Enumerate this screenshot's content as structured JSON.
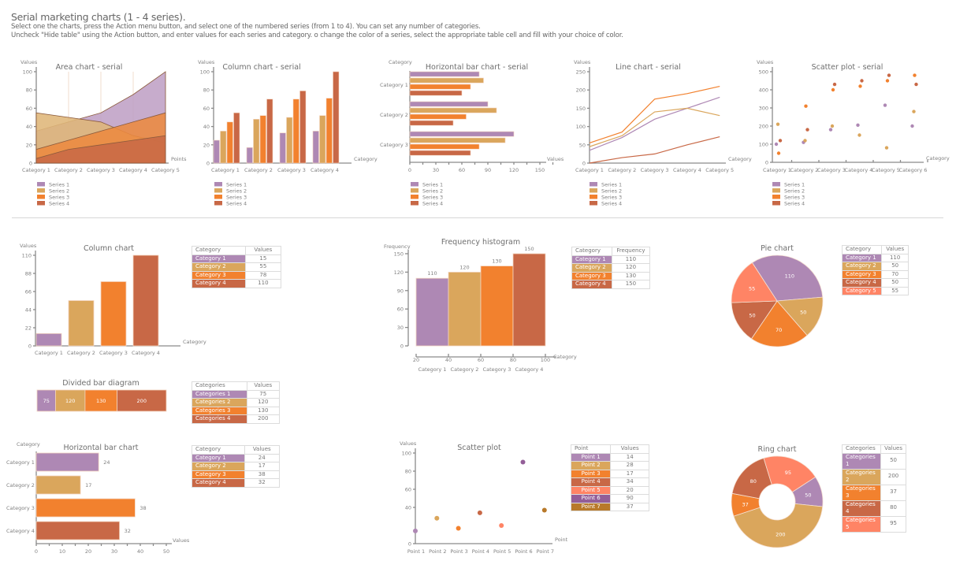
{
  "header": {
    "title": "Serial marketing charts (1 - 4 series).",
    "line1": "Select one the charts, press the Action menu button, and select one of the numbered series (from 1 to 4). You can set any number of categories.",
    "line2": "Uncheck \"Hide table\" using the Action button, and enter values for each series and category. o change the color of a series, select the appropriate table cell and fill with your choice of color."
  },
  "colors": {
    "c1": "#AE88B4",
    "c2": "#DAA65C",
    "c3": "#F2812E",
    "c4": "#C86846",
    "c5": "#FF8465",
    "c6": "#935E98",
    "c7": "#B8792A"
  },
  "chart_data": [
    {
      "id": "area",
      "type": "area",
      "title": "Area chart - serial",
      "ylabel": "Values",
      "xlabel": "Points",
      "ylim": [
        0,
        100
      ],
      "yticks": [
        0,
        20,
        40,
        60,
        80,
        100
      ],
      "categories": [
        "Category 1",
        "Category 2",
        "Category 3",
        "Category 4",
        "Category 5"
      ],
      "series": [
        {
          "name": "Series 1",
          "values": [
            35,
            45,
            55,
            75,
            100
          ]
        },
        {
          "name": "Series 2",
          "values": [
            55,
            50,
            45,
            30,
            22
          ]
        },
        {
          "name": "Series 3",
          "values": [
            15,
            25,
            35,
            45,
            55
          ]
        },
        {
          "name": "Series 4",
          "values": [
            5,
            15,
            20,
            25,
            30
          ]
        }
      ],
      "legend": "bottom-left"
    },
    {
      "id": "colserial",
      "type": "bar",
      "title": "Column chart - serial",
      "ylabel": "Values",
      "xlabel": "Category",
      "ylim": [
        0,
        100
      ],
      "yticks": [
        0,
        20,
        40,
        60,
        80,
        100
      ],
      "categories": [
        "Category 1",
        "Category 2",
        "Category 3",
        "Category 4"
      ],
      "series": [
        {
          "name": "Series 1",
          "values": [
            25,
            17,
            33,
            35
          ]
        },
        {
          "name": "Series 2",
          "values": [
            35,
            48,
            50,
            52
          ]
        },
        {
          "name": "Series 3",
          "values": [
            45,
            52,
            70,
            71
          ]
        },
        {
          "name": "Series 4",
          "values": [
            55,
            70,
            79,
            100
          ]
        }
      ],
      "legend": "bottom-left"
    },
    {
      "id": "hbarserial",
      "type": "bar",
      "orientation": "horizontal",
      "title": "Horizontal bar chart - serial",
      "ylabel": "Category",
      "xlabel": "Values",
      "xlim": [
        0,
        160
      ],
      "xticks": [
        0,
        30,
        60,
        90,
        120,
        150
      ],
      "categories": [
        "Category 1",
        "Category 2",
        "Category 3"
      ],
      "series": [
        {
          "name": "Series 1",
          "values": [
            80,
            90,
            120
          ]
        },
        {
          "name": "Series 2",
          "values": [
            85,
            100,
            110
          ]
        },
        {
          "name": "Series 3",
          "values": [
            70,
            65,
            80
          ]
        },
        {
          "name": "Series 4",
          "values": [
            60,
            50,
            70
          ]
        }
      ],
      "legend": "bottom-left"
    },
    {
      "id": "lineserial",
      "type": "line",
      "title": "Line chart - serial",
      "ylabel": "Values",
      "xlabel": "Category",
      "ylim": [
        0,
        250
      ],
      "yticks": [
        0,
        50,
        100,
        150,
        200,
        250
      ],
      "categories": [
        "Category 1",
        "Category 2",
        "Category 3",
        "Category 4",
        "Category 5"
      ],
      "series": [
        {
          "name": "Series 1",
          "values": [
            35,
            70,
            120,
            150,
            180
          ]
        },
        {
          "name": "Series 2",
          "values": [
            45,
            75,
            140,
            150,
            130
          ]
        },
        {
          "name": "Series 3",
          "values": [
            55,
            85,
            175,
            190,
            210
          ]
        },
        {
          "name": "Series 4",
          "values": [
            0,
            15,
            25,
            50,
            72
          ]
        }
      ],
      "legend": "bottom-left"
    },
    {
      "id": "scatterserial",
      "type": "scatter",
      "title": "Scatter plot - serial",
      "ylabel": "Values",
      "xlabel": "Category",
      "ylim": [
        0,
        500
      ],
      "yticks": [
        0,
        100,
        200,
        300,
        400,
        500
      ],
      "categories": [
        "Category 1",
        "Category 2",
        "Category 3",
        "Category 4",
        "Category 5",
        "Category 6"
      ],
      "series": [
        {
          "name": "Series 1",
          "values": [
            100,
            110,
            180,
            205,
            315,
            200
          ]
        },
        {
          "name": "Series 2",
          "values": [
            210,
            120,
            200,
            150,
            80,
            280
          ]
        },
        {
          "name": "Series 3",
          "values": [
            50,
            310,
            400,
            420,
            450,
            480
          ]
        },
        {
          "name": "Series 4",
          "values": [
            120,
            180,
            430,
            450,
            480,
            430
          ]
        }
      ],
      "legend": "bottom-left"
    },
    {
      "id": "column",
      "type": "bar",
      "title": "Column chart",
      "ylabel": "Values",
      "xlabel": "Category",
      "ylim": [
        0,
        110
      ],
      "yticks": [
        0,
        22,
        44,
        66,
        88,
        110
      ],
      "categories": [
        "Category 1",
        "Category 2",
        "Category 3",
        "Category 4"
      ],
      "values": [
        15,
        55,
        78,
        110
      ],
      "table": {
        "headers": [
          "Category",
          "Values"
        ]
      }
    },
    {
      "id": "histogram",
      "type": "bar",
      "title": "Frequency histogram",
      "ylabel": "Frequency",
      "xlabel": "Category",
      "ylim": [
        0,
        150
      ],
      "yticks": [
        0,
        30,
        60,
        90,
        120,
        150
      ],
      "xticks": [
        20,
        40,
        60,
        80,
        100
      ],
      "categories": [
        "Category 1",
        "Category 2",
        "Category 3",
        "Category 4"
      ],
      "values": [
        110,
        120,
        130,
        150
      ],
      "table": {
        "headers": [
          "Category",
          "Frequency"
        ]
      }
    },
    {
      "id": "pie",
      "type": "pie",
      "title": "Pie chart",
      "categories": [
        "Category 1",
        "Category 2",
        "Category 3",
        "Category 4",
        "Category 5"
      ],
      "values": [
        110,
        50,
        70,
        50,
        55
      ],
      "table": {
        "headers": [
          "Category",
          "Values"
        ]
      }
    },
    {
      "id": "divided",
      "type": "bar",
      "orientation": "stacked-horizontal",
      "title": "Divided bar diagram",
      "categories": [
        "Categories 1",
        "Categories 2",
        "Categories 3",
        "Categories 4"
      ],
      "values": [
        75,
        120,
        130,
        200
      ],
      "table": {
        "headers": [
          "Categories",
          "Values"
        ]
      }
    },
    {
      "id": "hbar",
      "type": "bar",
      "orientation": "horizontal",
      "title": "Horizontal bar chart",
      "ylabel": "Category",
      "xlabel": "Values",
      "xlim": [
        0,
        50
      ],
      "xticks": [
        0,
        10,
        20,
        30,
        40,
        50
      ],
      "categories": [
        "Category 1",
        "Category 2",
        "Category 3",
        "Category 4"
      ],
      "values": [
        24,
        17,
        38,
        32
      ],
      "table": {
        "headers": [
          "Category",
          "Values"
        ]
      }
    },
    {
      "id": "scatter",
      "type": "scatter",
      "title": "Scatter plot",
      "ylabel": "Values",
      "xlabel": "Point",
      "ylim": [
        0,
        100
      ],
      "yticks": [
        0,
        40,
        60,
        80,
        100
      ],
      "categories": [
        "Point 1",
        "Point 2",
        "Point 3",
        "Point 4",
        "Point 5",
        "Point 6",
        "Point 7"
      ],
      "values": [
        14,
        28,
        17,
        34,
        20,
        90,
        37
      ],
      "table": {
        "headers": [
          "Point",
          "Values"
        ]
      }
    },
    {
      "id": "ring",
      "type": "pie",
      "variant": "ring",
      "title": "Ring chart",
      "categories": [
        "Categories 1",
        "Categories 2",
        "Categories 3",
        "Categories 4",
        "Categories 5"
      ],
      "values": [
        50,
        200,
        37,
        80,
        95
      ],
      "table": {
        "headers": [
          "Categories",
          "Values"
        ]
      }
    }
  ]
}
